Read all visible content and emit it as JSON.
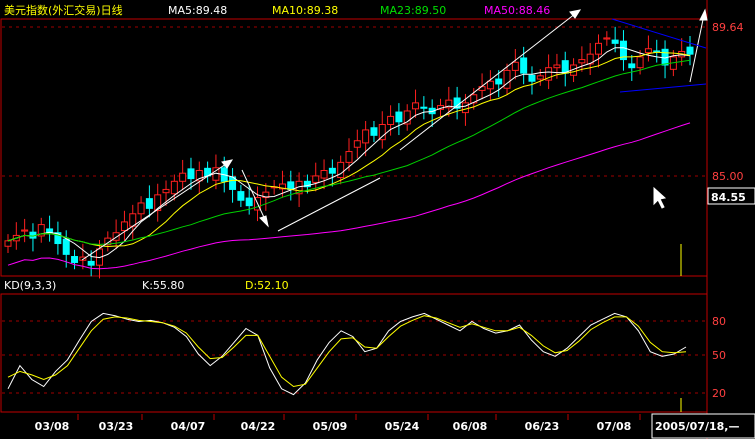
{
  "header": {
    "title": "美元指数(外汇交易)日线",
    "ma5": "MA5:89.48",
    "ma10": "MA10:89.38",
    "ma23": "MA23:89.50",
    "ma50": "MA50:88.46"
  },
  "kd": {
    "label": "KD(9,3,3)",
    "k": "K:55.80",
    "d": "D:52.10"
  },
  "price_axis": {
    "top_label": "89.64",
    "mid_label": "85.00",
    "current_label": "84.55"
  },
  "kd_axis": {
    "labels": [
      "80",
      "50",
      "20"
    ]
  },
  "date_axis": {
    "labels": [
      "03/08",
      "03/23",
      "04/07",
      "04/22",
      "05/09",
      "05/24",
      "06/08",
      "06/23",
      "07/08"
    ],
    "current": "2005/07/18,—"
  },
  "colors": {
    "background": "#000000",
    "up": "#ff2020",
    "down": "#00ffff",
    "ma5": "#ffffff",
    "ma10": "#ffff00",
    "ma23": "#00d000",
    "ma50": "#ff00ff",
    "k_line": "#ffffff",
    "d_line": "#ffff00",
    "grid": "#a00000",
    "frame": "#c00000",
    "trend": "#0000ff"
  },
  "chart_data": [
    {
      "type": "candlestick",
      "title": "美元指数(外汇交易)日线",
      "series": [
        {
          "name": "MA5",
          "last": 89.48
        },
        {
          "name": "MA10",
          "last": 89.38
        },
        {
          "name": "MA23",
          "last": 89.5
        },
        {
          "name": "MA50",
          "last": 88.46
        }
      ],
      "ylim": [
        80.8,
        90.3
      ],
      "price_labels": [
        89.64,
        85.0,
        84.55
      ],
      "x_ticks": [
        "03/08",
        "03/23",
        "04/07",
        "04/22",
        "05/09",
        "05/24",
        "06/08",
        "06/23",
        "07/08"
      ],
      "closes": [
        82.1,
        82.3,
        82.5,
        82.2,
        82.7,
        82.4,
        82.0,
        81.6,
        81.3,
        81.5,
        81.2,
        81.8,
        82.2,
        82.4,
        82.8,
        83.1,
        83.5,
        83.3,
        83.8,
        84.0,
        84.3,
        84.6,
        84.4,
        84.7,
        84.5,
        84.8,
        84.3,
        84.0,
        83.6,
        83.4,
        83.7,
        83.9,
        84.1,
        84.2,
        84.0,
        84.3,
        84.1,
        84.5,
        84.7,
        84.6,
        85.0,
        85.4,
        85.8,
        86.2,
        86.0,
        86.4,
        86.7,
        86.5,
        86.9,
        87.2,
        87.0,
        86.8,
        87.1,
        87.3,
        87.0,
        87.2,
        87.5,
        87.8,
        88.0,
        87.9,
        88.4,
        88.7,
        88.3,
        88.0,
        88.2,
        88.5,
        88.6,
        88.3,
        88.6,
        88.8,
        89.0,
        89.4,
        89.6,
        89.4,
        88.8,
        88.5,
        88.9,
        89.2,
        89.1,
        88.6,
        88.9,
        89.1,
        89.0
      ]
    },
    {
      "type": "line",
      "title": "KD(9,3,3)",
      "series": [
        {
          "name": "K",
          "last": 55.8,
          "values": [
            20,
            40,
            28,
            22,
            35,
            45,
            62,
            78,
            85,
            83,
            80,
            78,
            79,
            77,
            73,
            65,
            50,
            40,
            48,
            60,
            72,
            66,
            38,
            20,
            15,
            25,
            45,
            60,
            70,
            65,
            52,
            55,
            70,
            78,
            82,
            85,
            80,
            75,
            70,
            78,
            72,
            68,
            70,
            75,
            62,
            52,
            48,
            55,
            65,
            75,
            80,
            85,
            82,
            70,
            52,
            48,
            50,
            56
          ]
        },
        {
          "name": "D",
          "last": 52.1,
          "values": [
            30,
            35,
            32,
            28,
            32,
            40,
            55,
            70,
            80,
            82,
            81,
            79,
            78,
            77,
            74,
            68,
            56,
            46,
            47,
            56,
            66,
            66,
            48,
            30,
            22,
            24,
            38,
            52,
            63,
            64,
            56,
            55,
            65,
            74,
            79,
            83,
            81,
            77,
            73,
            76,
            73,
            70,
            70,
            73,
            66,
            57,
            51,
            53,
            61,
            71,
            77,
            82,
            82,
            74,
            60,
            52,
            51,
            52
          ]
        }
      ],
      "ylim": [
        0,
        100
      ],
      "levels": [
        80,
        50,
        20
      ]
    }
  ]
}
